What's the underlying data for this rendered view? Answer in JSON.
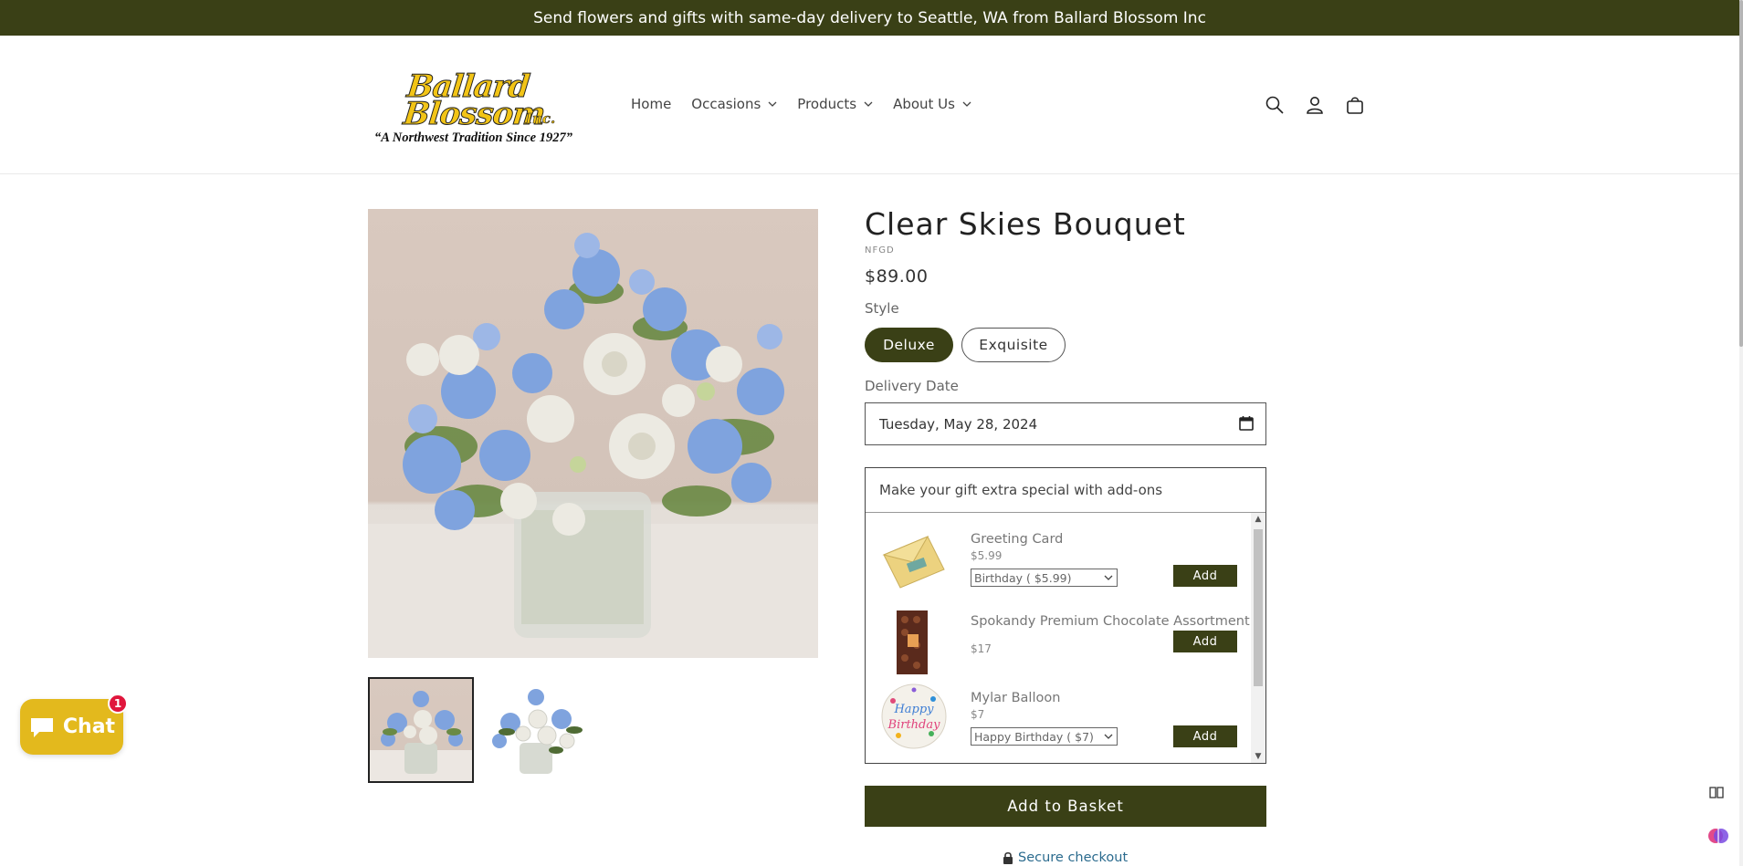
{
  "announcement": "Send flowers and gifts with same-day delivery to Seattle, WA from Ballard Blossom Inc",
  "logo": {
    "line1": "Ballard",
    "line2": "Blossom",
    "inc": "Inc.",
    "tagline": "“A Northwest Tradition Since 1927”"
  },
  "nav": {
    "items": [
      {
        "label": "Home",
        "dropdown": false
      },
      {
        "label": "Occasions",
        "dropdown": true
      },
      {
        "label": "Products",
        "dropdown": true
      },
      {
        "label": "About Us",
        "dropdown": true
      }
    ]
  },
  "header_icons": [
    "search-icon",
    "account-icon",
    "cart-icon"
  ],
  "product": {
    "title": "Clear Skies Bouquet",
    "sku": "NFGD",
    "price": "$89.00",
    "style_label": "Style",
    "styles": [
      {
        "label": "Deluxe",
        "selected": true
      },
      {
        "label": "Exquisite",
        "selected": false
      }
    ],
    "delivery_label": "Delivery Date",
    "delivery_value": "Tuesday, May 28, 2024"
  },
  "addons": {
    "heading": "Make your gift extra special with add-ons",
    "items": [
      {
        "name": "Greeting Card",
        "price": "$5.99",
        "option": "Birthday ( $5.99)",
        "button": "Add"
      },
      {
        "name": "Spokandy Premium Chocolate Assortment",
        "price": "$17",
        "button": "Add"
      },
      {
        "name": "Mylar Balloon",
        "price": "$7",
        "option": "Happy Birthday ( $7)",
        "button": "Add"
      }
    ]
  },
  "basket_button": "Add to Basket",
  "secure_checkout": "Secure checkout",
  "chat": {
    "label": "Chat",
    "badge": "1"
  },
  "colors": {
    "brand": "#3a4016",
    "chat": "#e3b91d",
    "badge": "#e0163c",
    "link": "#2b6b8e"
  }
}
